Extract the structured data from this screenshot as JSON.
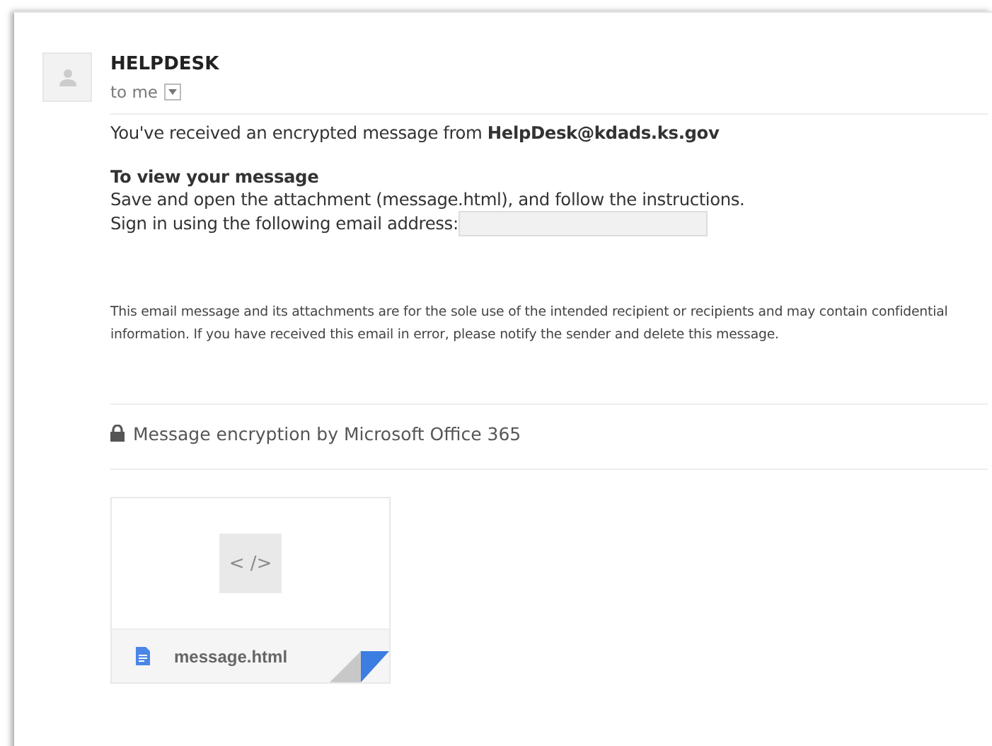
{
  "sender": {
    "name": "HELPDESK",
    "recipient": "to me"
  },
  "message": {
    "intro": "You've received an encrypted message from **HelpDesk@kdads.ks.gov**",
    "heading": "To view your message",
    "steps": [
      "Save and open the attachment (message.html), and follow the instructions.",
      "Sign in using the following email address:"
    ],
    "disclaimer": "This email message and its attachments are for the sole use of the intended recipient or recipients and may contain confidential information. If you have received this email in error, please notify the sender and delete this message.",
    "encryption_note": "Message encryption by Microsoft Office 365"
  },
  "attachment": {
    "thumbnail": "< />",
    "filename": "message.html"
  }
}
